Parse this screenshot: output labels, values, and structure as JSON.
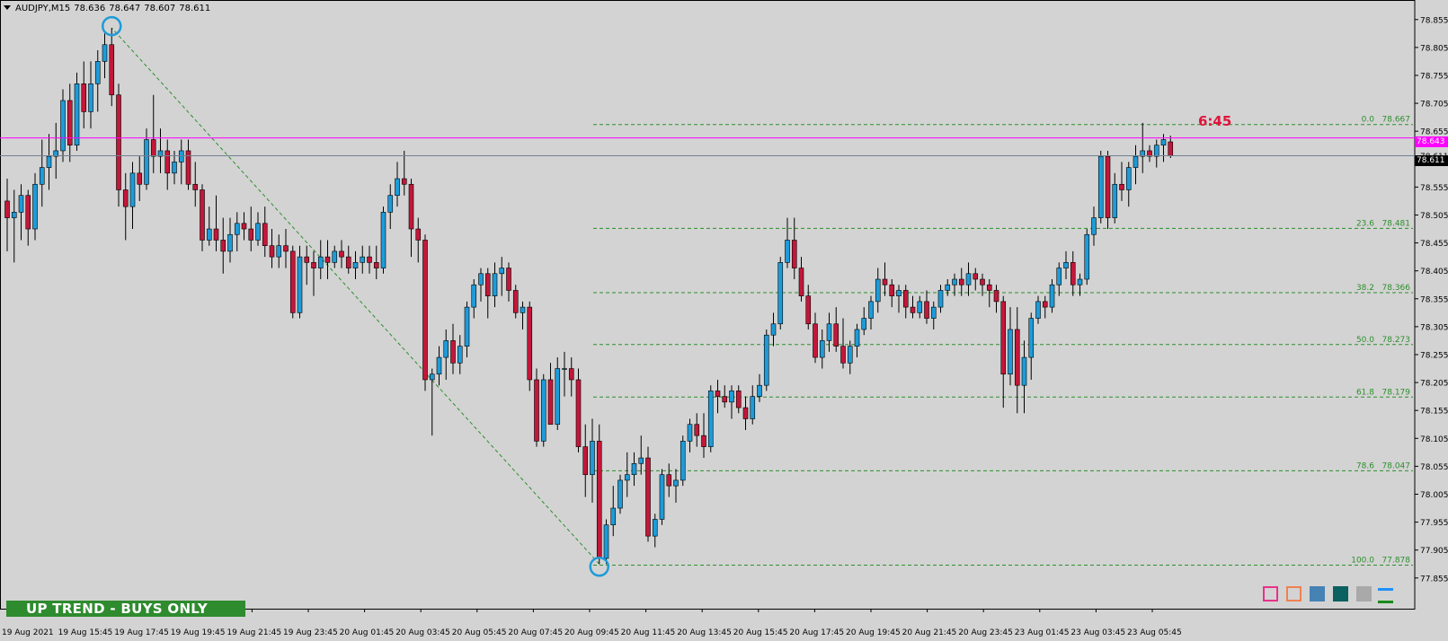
{
  "header": {
    "symbol": "AUDJPY,M15",
    "open": "78.636",
    "high": "78.647",
    "low": "78.607",
    "close": "78.611"
  },
  "timer": "6:45",
  "trend_banner": "UP TREND - BUYS ONLY",
  "current_price": "78.611",
  "line_price": "78.643",
  "colors": {
    "background": "#d3d3d3",
    "bull": "#1e9bd8",
    "bear": "#c3173a",
    "fib": "#2d8f2d",
    "magenta": "#ff00ff",
    "banner": "#2e8b2e",
    "timer": "#e0143c",
    "swing_marker": "#1e9bd8"
  },
  "icons": [
    "pink-square-icon",
    "orange-square-icon",
    "blue-square-icon",
    "teal-square-icon",
    "gray-square-icon",
    "blue-dash-icon",
    "green-dash-icon"
  ],
  "chart_data": {
    "type": "candlestick",
    "title": "AUDJPY,M15",
    "ylim": [
      77.8,
      78.89
    ],
    "y_ticks": [
      "78.855",
      "78.805",
      "78.755",
      "78.705",
      "78.655",
      "78.611",
      "78.555",
      "78.505",
      "78.455",
      "78.405",
      "78.355",
      "78.305",
      "78.255",
      "78.205",
      "78.155",
      "78.105",
      "78.055",
      "78.005",
      "77.955",
      "77.905",
      "77.855"
    ],
    "x_ticks": [
      "19 Aug 2021",
      "19 Aug 15:45",
      "19 Aug 17:45",
      "19 Aug 19:45",
      "19 Aug 21:45",
      "19 Aug 23:45",
      "20 Aug 01:45",
      "20 Aug 03:45",
      "20 Aug 05:45",
      "20 Aug 07:45",
      "20 Aug 09:45",
      "20 Aug 11:45",
      "20 Aug 13:45",
      "20 Aug 15:45",
      "20 Aug 17:45",
      "20 Aug 19:45",
      "20 Aug 21:45",
      "20 Aug 23:45",
      "23 Aug 01:45",
      "23 Aug 03:45",
      "23 Aug 05:45"
    ],
    "fibonacci": [
      {
        "level": "0.0",
        "price": "78.667"
      },
      {
        "level": "23.6",
        "price": "78.481"
      },
      {
        "level": "38.2",
        "price": "78.366"
      },
      {
        "level": "50.0",
        "price": "78.273"
      },
      {
        "level": "61.8",
        "price": "78.179"
      },
      {
        "level": "78.6",
        "price": "78.047"
      },
      {
        "level": "100.0",
        "price": "77.878"
      }
    ],
    "ohlc": [
      [
        78.53,
        78.57,
        78.44,
        78.5
      ],
      [
        78.5,
        78.55,
        78.42,
        78.51
      ],
      [
        78.51,
        78.56,
        78.46,
        78.54
      ],
      [
        78.54,
        78.55,
        78.45,
        78.48
      ],
      [
        78.48,
        78.58,
        78.46,
        78.56
      ],
      [
        78.56,
        78.64,
        78.52,
        78.59
      ],
      [
        78.59,
        78.65,
        78.55,
        78.61
      ],
      [
        78.61,
        78.67,
        78.57,
        78.62
      ],
      [
        78.62,
        78.73,
        78.6,
        78.71
      ],
      [
        78.71,
        78.74,
        78.6,
        78.63
      ],
      [
        78.63,
        78.76,
        78.62,
        78.74
      ],
      [
        78.74,
        78.78,
        78.66,
        78.69
      ],
      [
        78.69,
        78.78,
        78.66,
        78.74
      ],
      [
        78.74,
        78.8,
        78.69,
        78.78
      ],
      [
        78.78,
        78.83,
        78.75,
        78.81
      ],
      [
        78.81,
        78.84,
        78.7,
        78.72
      ],
      [
        78.72,
        78.74,
        78.52,
        78.55
      ],
      [
        78.55,
        78.58,
        78.46,
        78.52
      ],
      [
        78.52,
        78.6,
        78.48,
        78.58
      ],
      [
        78.58,
        78.61,
        78.53,
        78.56
      ],
      [
        78.56,
        78.66,
        78.55,
        78.64
      ],
      [
        78.64,
        78.72,
        78.58,
        78.61
      ],
      [
        78.61,
        78.66,
        78.58,
        78.62
      ],
      [
        78.62,
        78.64,
        78.55,
        78.58
      ],
      [
        78.58,
        78.62,
        78.56,
        78.6
      ],
      [
        78.6,
        78.64,
        78.56,
        78.62
      ],
      [
        78.62,
        78.64,
        78.55,
        78.56
      ],
      [
        78.56,
        78.6,
        78.52,
        78.55
      ],
      [
        78.55,
        78.56,
        78.44,
        78.46
      ],
      [
        78.46,
        78.52,
        78.45,
        78.48
      ],
      [
        78.48,
        78.54,
        78.44,
        78.46
      ],
      [
        78.46,
        78.5,
        78.4,
        78.44
      ],
      [
        78.44,
        78.5,
        78.42,
        78.47
      ],
      [
        78.47,
        78.51,
        78.44,
        78.49
      ],
      [
        78.49,
        78.51,
        78.46,
        78.48
      ],
      [
        78.48,
        78.52,
        78.44,
        78.46
      ],
      [
        78.46,
        78.51,
        78.45,
        78.49
      ],
      [
        78.49,
        78.52,
        78.43,
        78.45
      ],
      [
        78.45,
        78.48,
        78.41,
        78.43
      ],
      [
        78.43,
        78.47,
        78.41,
        78.45
      ],
      [
        78.45,
        78.48,
        78.41,
        78.44
      ],
      [
        78.44,
        78.45,
        78.32,
        78.33
      ],
      [
        78.33,
        78.45,
        78.32,
        78.43
      ],
      [
        78.43,
        78.45,
        78.38,
        78.42
      ],
      [
        78.42,
        78.44,
        78.36,
        78.41
      ],
      [
        78.41,
        78.46,
        78.39,
        78.43
      ],
      [
        78.43,
        78.46,
        78.39,
        78.42
      ],
      [
        78.42,
        78.45,
        78.41,
        78.44
      ],
      [
        78.44,
        78.46,
        78.41,
        78.43
      ],
      [
        78.43,
        78.45,
        78.4,
        78.41
      ],
      [
        78.41,
        78.44,
        78.39,
        78.42
      ],
      [
        78.42,
        78.45,
        78.4,
        78.43
      ],
      [
        78.43,
        78.45,
        78.4,
        78.42
      ],
      [
        78.42,
        78.45,
        78.39,
        78.41
      ],
      [
        78.41,
        78.52,
        78.4,
        78.51
      ],
      [
        78.51,
        78.56,
        78.48,
        78.54
      ],
      [
        78.54,
        78.6,
        78.52,
        78.57
      ],
      [
        78.57,
        78.62,
        78.54,
        78.56
      ],
      [
        78.56,
        78.57,
        78.43,
        78.48
      ],
      [
        78.48,
        78.5,
        78.42,
        78.46
      ],
      [
        78.46,
        78.47,
        78.19,
        78.21
      ],
      [
        78.21,
        78.23,
        78.11,
        78.22
      ],
      [
        78.22,
        78.27,
        78.2,
        78.25
      ],
      [
        78.25,
        78.3,
        78.21,
        78.28
      ],
      [
        78.28,
        78.31,
        78.22,
        78.24
      ],
      [
        78.24,
        78.29,
        78.22,
        78.27
      ],
      [
        78.27,
        78.35,
        78.25,
        78.34
      ],
      [
        78.34,
        78.39,
        78.32,
        78.38
      ],
      [
        78.38,
        78.41,
        78.35,
        78.4
      ],
      [
        78.4,
        78.41,
        78.32,
        78.36
      ],
      [
        78.36,
        78.42,
        78.34,
        78.4
      ],
      [
        78.4,
        78.43,
        78.36,
        78.41
      ],
      [
        78.41,
        78.42,
        78.35,
        78.37
      ],
      [
        78.37,
        78.38,
        78.32,
        78.33
      ],
      [
        78.33,
        78.35,
        78.3,
        78.34
      ],
      [
        78.34,
        78.35,
        78.19,
        78.21
      ],
      [
        78.21,
        78.23,
        78.09,
        78.1
      ],
      [
        78.1,
        78.22,
        78.09,
        78.21
      ],
      [
        78.21,
        78.24,
        78.14,
        78.13
      ],
      [
        78.13,
        78.25,
        78.12,
        78.23
      ],
      [
        78.23,
        78.26,
        78.18,
        78.23
      ],
      [
        78.23,
        78.25,
        78.18,
        78.21
      ],
      [
        78.21,
        78.23,
        78.08,
        78.09
      ],
      [
        78.09,
        78.13,
        78.0,
        78.04
      ],
      [
        78.04,
        78.14,
        77.99,
        78.1
      ],
      [
        78.1,
        78.13,
        77.88,
        77.89
      ],
      [
        77.89,
        77.96,
        77.88,
        77.95
      ],
      [
        77.95,
        78.02,
        77.93,
        77.98
      ],
      [
        77.98,
        78.04,
        77.97,
        78.03
      ],
      [
        78.03,
        78.08,
        78.0,
        78.04
      ],
      [
        78.04,
        78.08,
        78.02,
        78.06
      ],
      [
        78.06,
        78.11,
        78.04,
        78.07
      ],
      [
        78.07,
        78.09,
        77.92,
        77.93
      ],
      [
        77.93,
        77.97,
        77.91,
        77.96
      ],
      [
        77.96,
        78.05,
        77.95,
        78.04
      ],
      [
        78.04,
        78.06,
        78.0,
        78.02
      ],
      [
        78.02,
        78.05,
        77.99,
        78.03
      ],
      [
        78.03,
        78.11,
        78.02,
        78.1
      ],
      [
        78.1,
        78.14,
        78.08,
        78.13
      ],
      [
        78.13,
        78.15,
        78.09,
        78.11
      ],
      [
        78.11,
        78.15,
        78.07,
        78.09
      ],
      [
        78.09,
        78.2,
        78.08,
        78.19
      ],
      [
        78.19,
        78.21,
        78.15,
        78.18
      ],
      [
        78.18,
        78.2,
        78.16,
        78.17
      ],
      [
        78.17,
        78.2,
        78.14,
        78.19
      ],
      [
        78.19,
        78.2,
        78.15,
        78.16
      ],
      [
        78.16,
        78.18,
        78.12,
        78.14
      ],
      [
        78.14,
        78.2,
        78.13,
        78.18
      ],
      [
        78.18,
        78.22,
        78.17,
        78.2
      ],
      [
        78.2,
        78.3,
        78.19,
        78.29
      ],
      [
        78.29,
        78.33,
        78.27,
        78.31
      ],
      [
        78.31,
        78.43,
        78.3,
        78.42
      ],
      [
        78.42,
        78.5,
        78.41,
        78.46
      ],
      [
        78.46,
        78.5,
        78.39,
        78.41
      ],
      [
        78.41,
        78.43,
        78.35,
        78.36
      ],
      [
        78.36,
        78.38,
        78.3,
        78.31
      ],
      [
        78.31,
        78.33,
        78.24,
        78.25
      ],
      [
        78.25,
        78.3,
        78.23,
        78.28
      ],
      [
        78.28,
        78.33,
        78.26,
        78.31
      ],
      [
        78.31,
        78.34,
        78.26,
        78.27
      ],
      [
        78.27,
        78.32,
        78.23,
        78.24
      ],
      [
        78.24,
        78.28,
        78.22,
        78.27
      ],
      [
        78.27,
        78.31,
        78.25,
        78.3
      ],
      [
        78.3,
        78.34,
        78.29,
        78.32
      ],
      [
        78.32,
        78.36,
        78.3,
        78.35
      ],
      [
        78.35,
        78.41,
        78.33,
        78.39
      ],
      [
        78.39,
        78.42,
        78.36,
        78.38
      ],
      [
        78.38,
        78.39,
        78.34,
        78.36
      ],
      [
        78.36,
        78.38,
        78.33,
        78.37
      ],
      [
        78.37,
        78.38,
        78.32,
        78.34
      ],
      [
        78.34,
        78.36,
        78.32,
        78.33
      ],
      [
        78.33,
        78.36,
        78.32,
        78.35
      ],
      [
        78.35,
        78.37,
        78.31,
        78.32
      ],
      [
        78.32,
        78.35,
        78.3,
        78.34
      ],
      [
        78.34,
        78.38,
        78.33,
        78.37
      ],
      [
        78.37,
        78.39,
        78.36,
        78.38
      ],
      [
        78.38,
        78.4,
        78.36,
        78.39
      ],
      [
        78.39,
        78.41,
        78.36,
        78.38
      ],
      [
        78.38,
        78.42,
        78.36,
        78.4
      ],
      [
        78.4,
        78.41,
        78.37,
        78.39
      ],
      [
        78.39,
        78.4,
        78.36,
        78.38
      ],
      [
        78.38,
        78.39,
        78.34,
        78.37
      ],
      [
        78.37,
        78.38,
        78.33,
        78.35
      ],
      [
        78.35,
        78.36,
        78.16,
        78.22
      ],
      [
        78.22,
        78.34,
        78.2,
        78.3
      ],
      [
        78.3,
        78.34,
        78.15,
        78.2
      ],
      [
        78.2,
        78.28,
        78.15,
        78.25
      ],
      [
        78.25,
        78.33,
        78.21,
        78.32
      ],
      [
        78.32,
        78.36,
        78.31,
        78.35
      ],
      [
        78.35,
        78.36,
        78.32,
        78.34
      ],
      [
        78.34,
        78.39,
        78.33,
        78.38
      ],
      [
        78.38,
        78.42,
        78.36,
        78.41
      ],
      [
        78.41,
        78.44,
        78.39,
        78.42
      ],
      [
        78.42,
        78.44,
        78.36,
        78.38
      ],
      [
        78.38,
        78.4,
        78.36,
        78.39
      ],
      [
        78.39,
        78.48,
        78.38,
        78.47
      ],
      [
        78.47,
        78.52,
        78.45,
        78.5
      ],
      [
        78.5,
        78.62,
        78.49,
        78.61
      ],
      [
        78.61,
        78.62,
        78.48,
        78.5
      ],
      [
        78.5,
        78.58,
        78.49,
        78.56
      ],
      [
        78.56,
        78.6,
        78.53,
        78.55
      ],
      [
        78.55,
        78.6,
        78.52,
        78.59
      ],
      [
        78.59,
        78.63,
        78.56,
        78.61
      ],
      [
        78.61,
        78.67,
        78.58,
        78.62
      ],
      [
        78.62,
        78.63,
        78.6,
        78.61
      ],
      [
        78.61,
        78.64,
        78.59,
        78.63
      ],
      [
        78.63,
        78.65,
        78.6,
        78.64
      ],
      [
        78.636,
        78.647,
        78.607,
        78.611
      ]
    ]
  }
}
